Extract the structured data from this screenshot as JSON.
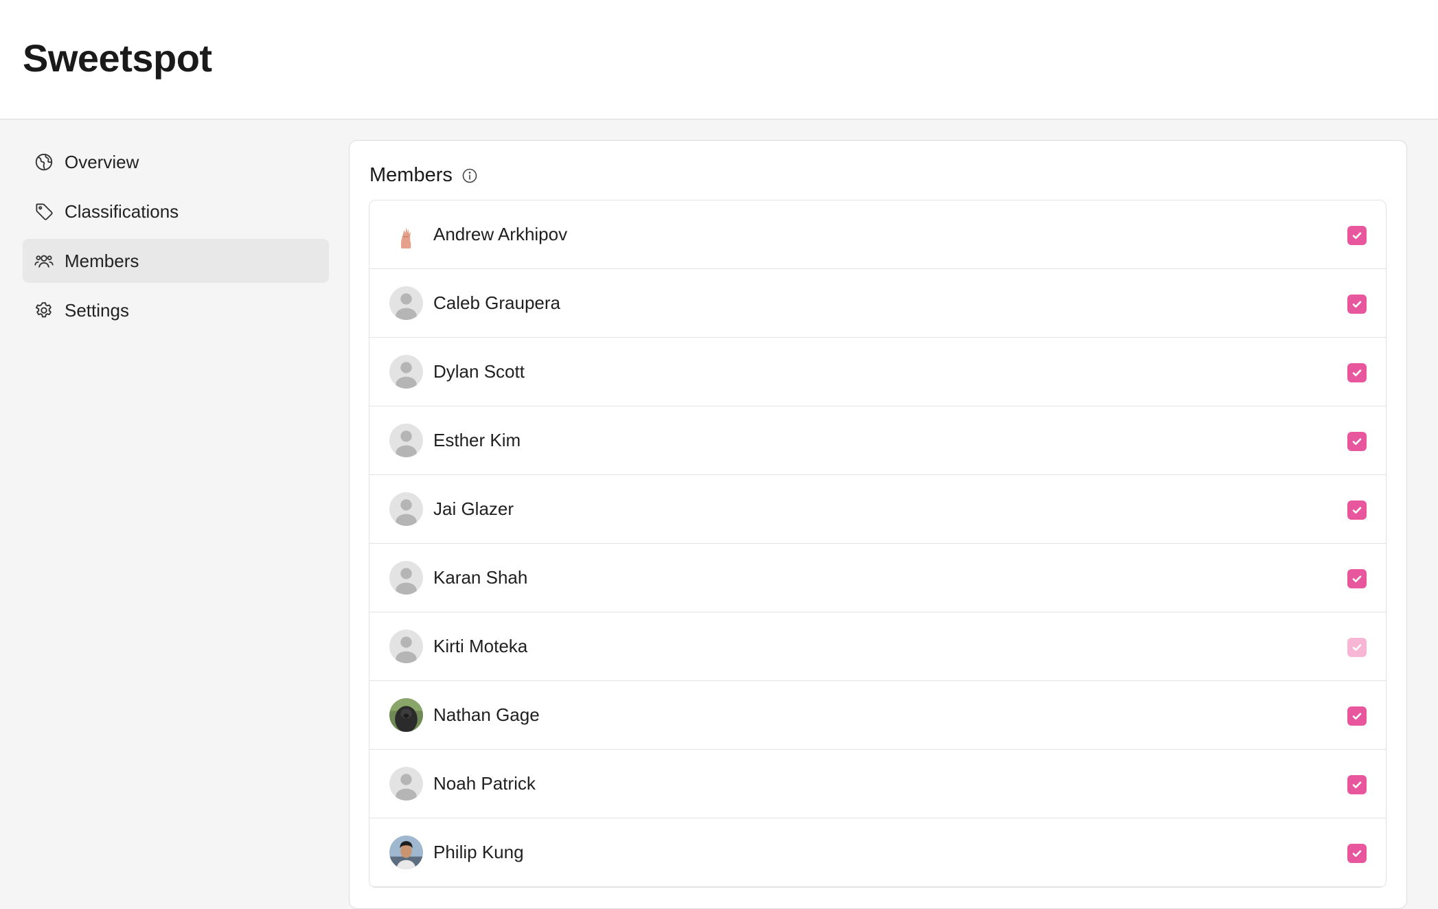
{
  "app": {
    "title": "Sweetspot"
  },
  "sidebar": {
    "items": [
      {
        "label": "Overview",
        "icon": "globe-icon",
        "active": false
      },
      {
        "label": "Classifications",
        "icon": "tag-icon",
        "active": false
      },
      {
        "label": "Members",
        "icon": "users-icon",
        "active": true
      },
      {
        "label": "Settings",
        "icon": "gear-icon",
        "active": false
      }
    ]
  },
  "members": {
    "title": "Members",
    "info_icon": "info-icon",
    "rows": [
      {
        "name": "Andrew Arkhipov",
        "avatar": "photo-hand-avatar",
        "checked": true,
        "disabled": false
      },
      {
        "name": "Caleb Graupera",
        "avatar": "default-avatar",
        "checked": true,
        "disabled": false
      },
      {
        "name": "Dylan Scott",
        "avatar": "default-avatar",
        "checked": true,
        "disabled": false
      },
      {
        "name": "Esther Kim",
        "avatar": "default-avatar",
        "checked": true,
        "disabled": false
      },
      {
        "name": "Jai Glazer",
        "avatar": "default-avatar",
        "checked": true,
        "disabled": false
      },
      {
        "name": "Karan Shah",
        "avatar": "default-avatar",
        "checked": true,
        "disabled": false
      },
      {
        "name": "Kirti Moteka",
        "avatar": "default-avatar",
        "checked": true,
        "disabled": true
      },
      {
        "name": "Nathan Gage",
        "avatar": "photo-gorilla-avatar",
        "checked": true,
        "disabled": false
      },
      {
        "name": "Noah Patrick",
        "avatar": "default-avatar",
        "checked": true,
        "disabled": false
      },
      {
        "name": "Philip Kung",
        "avatar": "photo-person-avatar",
        "checked": true,
        "disabled": false
      }
    ]
  },
  "colors": {
    "accent": "#e8579d",
    "accent_disabled": "#f7b6d3",
    "active_nav_bg": "#e8e8e9"
  }
}
